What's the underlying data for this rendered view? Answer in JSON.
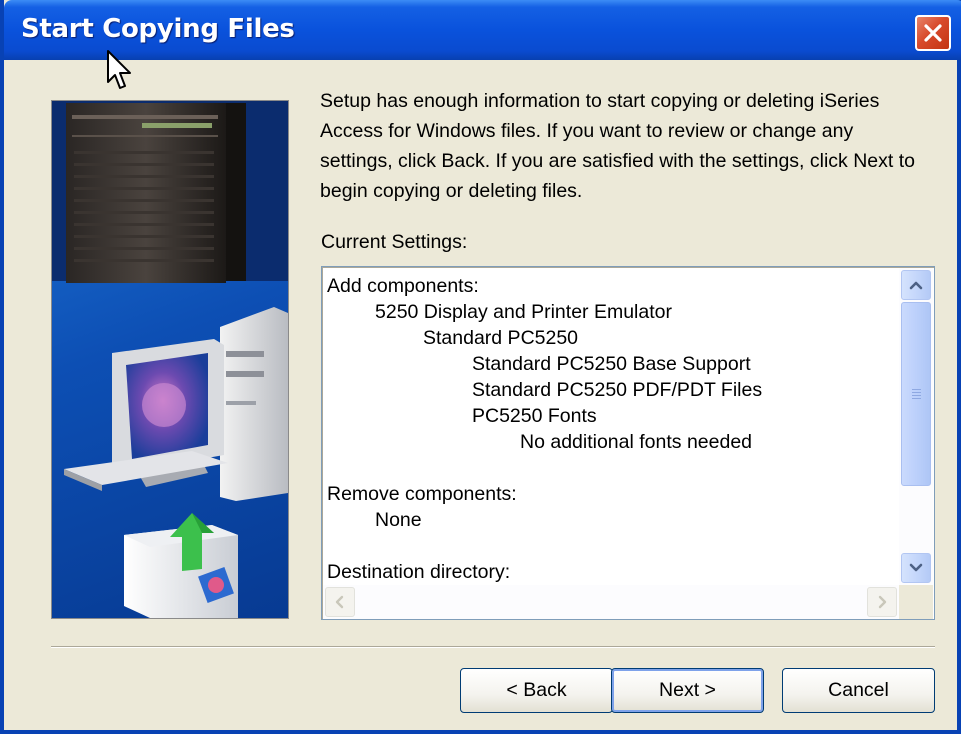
{
  "window": {
    "title": "Start Copying Files"
  },
  "intro_text": "Setup has enough information to start copying or deleting iSeries Access for Windows files.  If you want to review or change any settings, click Back.  If you are satisfied with the settings, click Next to begin copying or deleting files.",
  "current_settings": {
    "label": "Current Settings:",
    "lines": [
      {
        "text": "Add components:",
        "level": 0
      },
      {
        "text": "5250 Display and Printer Emulator",
        "level": 1
      },
      {
        "text": "Standard PC5250",
        "level": 2
      },
      {
        "text": "Standard PC5250 Base Support",
        "level": 3
      },
      {
        "text": "Standard PC5250 PDF/PDT Files",
        "level": 3
      },
      {
        "text": "PC5250 Fonts",
        "level": 3
      },
      {
        "text": "No additional fonts needed",
        "level": 4
      },
      {
        "text": "",
        "level": 0
      },
      {
        "text": "Remove components:",
        "level": 0
      },
      {
        "text": "None",
        "level": 1
      },
      {
        "text": "",
        "level": 0
      },
      {
        "text": "Destination directory:",
        "level": 0
      }
    ]
  },
  "buttons": {
    "back": "< Back",
    "next": "Next >",
    "cancel": "Cancel"
  },
  "icons": {
    "close": "close-icon",
    "cursor": "mouse-pointer-icon",
    "scroll_up": "arrow-up-icon",
    "scroll_down": "arrow-down-icon",
    "scroll_left": "arrow-left-icon",
    "scroll_right": "arrow-right-icon"
  },
  "colors": {
    "titlebar": "#0a52dc",
    "close_button": "#d84a2c",
    "dialog_background": "#ece9d8",
    "scrollbar": "#c5d7fb"
  }
}
